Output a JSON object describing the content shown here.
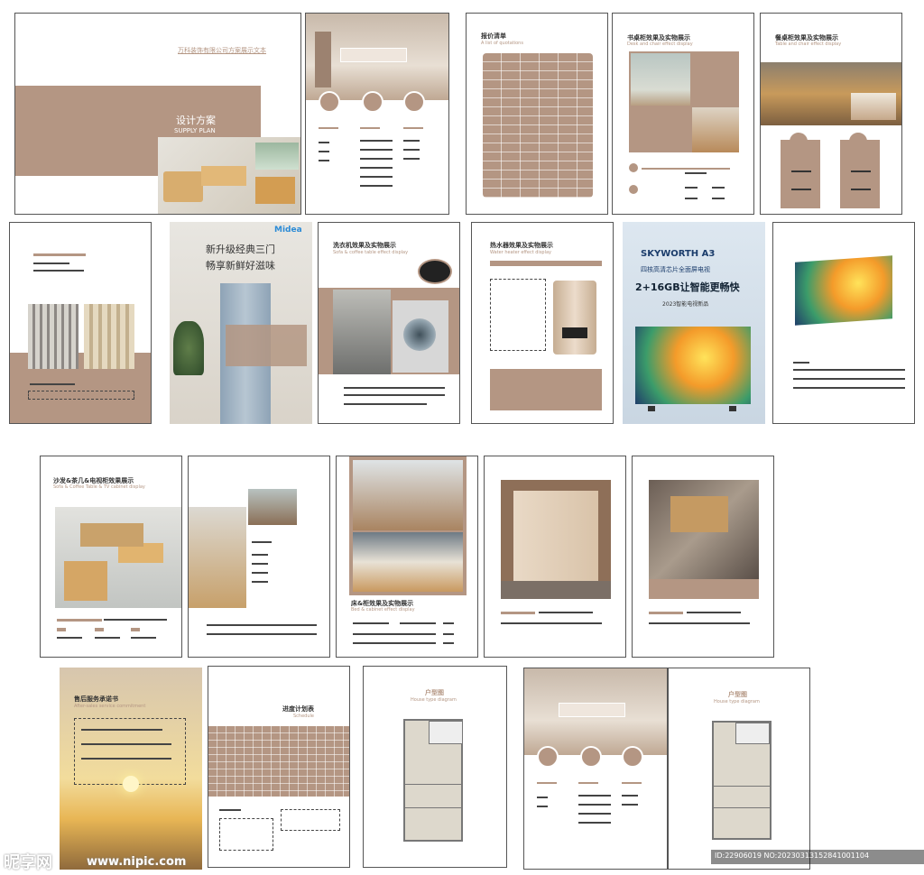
{
  "cover": {
    "company": "万科装饰有限公司方案展示文本",
    "title": "设计方案",
    "subtitle": "SUPPLY PLAN"
  },
  "quotation": {
    "title": "报价清单",
    "subtitle": "A list of quotations"
  },
  "desk": {
    "title": "书桌柜效果及实物展示",
    "subtitle": "Desk and chair effect display"
  },
  "table_chair": {
    "title": "餐桌柜效果及实物展示",
    "subtitle": "Table and chair effect display"
  },
  "fridge": {
    "brand": "Midea",
    "line1": "新升级经典三门",
    "line2": "畅享新鲜好滋味"
  },
  "washer": {
    "title": "洗衣机效果及实物展示",
    "subtitle": "Sofa & coffee table effect display"
  },
  "heater": {
    "title": "热水器效果及实物展示",
    "subtitle": "Water heater effect display"
  },
  "tv": {
    "brand": "SKYWORTH A3",
    "line1": "四核高清芯片全面屏电视",
    "line2": "2+16GB让智能更畅快",
    "line3": "2023智能电视新品"
  },
  "sofa": {
    "title": "沙发&茶几&电视柜效果展示",
    "subtitle": "Sofa & Coffee Table & TV cabinet display"
  },
  "bed": {
    "title": "床&柜效果及实物展示",
    "subtitle": "Bed & cabinet effect display"
  },
  "aftersale": {
    "title": "售后服务承诺书",
    "subtitle": "After-sales service commitment"
  },
  "schedule": {
    "title": "进度计划表",
    "subtitle": "Schedule"
  },
  "floorplan": {
    "title": "户型图",
    "subtitle": "House type diagram"
  },
  "floorplan2": {
    "title": "户型图",
    "subtitle": "House type diagram"
  },
  "watermark": {
    "logo": "昵享网",
    "url": "www.nipic.com",
    "id": "ID:22906019 NO:20230313152841001104"
  },
  "colors": {
    "accent": "#b49683",
    "ink": "#333333"
  }
}
